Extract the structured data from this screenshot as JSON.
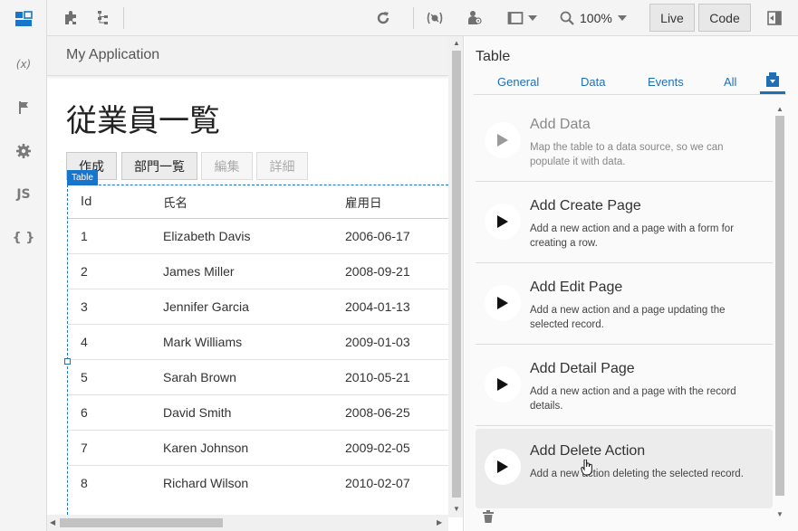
{
  "toolbar": {
    "zoom": "100%",
    "live_label": "Live",
    "code_label": "Code"
  },
  "rail": {
    "variables_label": "(x)",
    "js_label": "JS",
    "json_label": "{ }"
  },
  "app": {
    "title": "My Application",
    "page_title": "従業員一覧",
    "buttons": {
      "create": "作成",
      "departments": "部門一覧",
      "edit": "編集",
      "detail": "詳細"
    },
    "table_badge": "Table",
    "table": {
      "columns": [
        "Id",
        "氏名",
        "雇用日"
      ],
      "rows": [
        [
          "1",
          "Elizabeth Davis",
          "2006-06-17"
        ],
        [
          "2",
          "James Miller",
          "2008-09-21"
        ],
        [
          "3",
          "Jennifer Garcia",
          "2004-01-13"
        ],
        [
          "4",
          "Mark Williams",
          "2009-01-03"
        ],
        [
          "5",
          "Sarah Brown",
          "2010-05-21"
        ],
        [
          "6",
          "David Smith",
          "2008-06-25"
        ],
        [
          "7",
          "Karen Johnson",
          "2009-02-05"
        ],
        [
          "8",
          "Richard Wilson",
          "2010-02-07"
        ]
      ]
    }
  },
  "panel": {
    "title": "Table",
    "tabs": [
      "General",
      "Data",
      "Events",
      "All"
    ],
    "quick_actions": [
      {
        "title": "Add Data",
        "desc": "Map the table to a data source, so we can populate it with data."
      },
      {
        "title": "Add Create Page",
        "desc": "Add a new action and a page with a form for creating a row."
      },
      {
        "title": "Add Edit Page",
        "desc": "Add a new action and a page updating the selected record."
      },
      {
        "title": "Add Detail Page",
        "desc": "Add a new action and a page with the record details."
      },
      {
        "title": "Add Delete Action",
        "desc": "Add a new action deleting the selected record."
      }
    ]
  }
}
